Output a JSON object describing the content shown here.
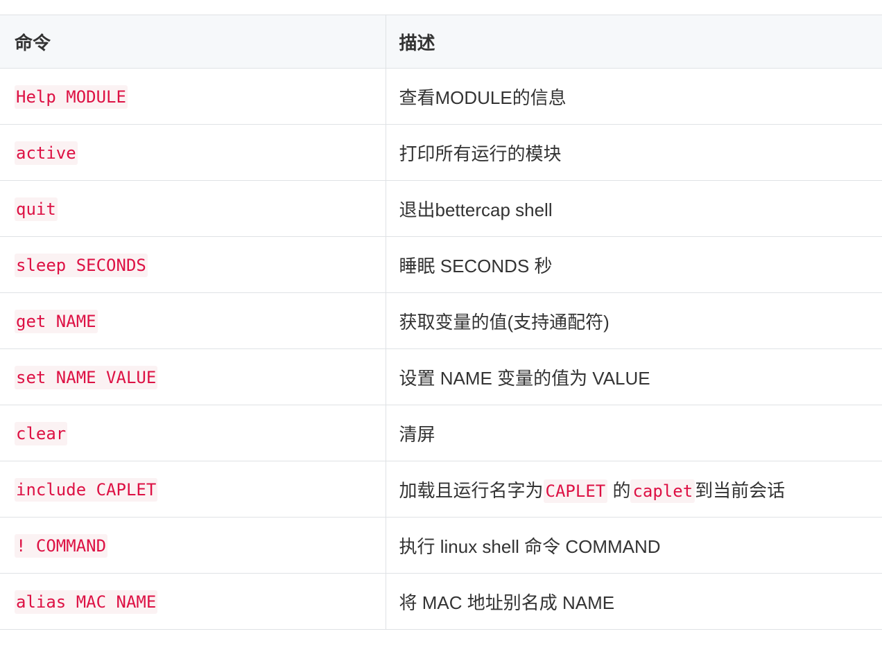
{
  "table": {
    "headers": {
      "command": "命令",
      "description": "描述"
    },
    "rows": [
      {
        "command": "Help MODULE",
        "description": "查看MODULE的信息"
      },
      {
        "command": "active",
        "description": "打印所有运行的模块"
      },
      {
        "command": "quit",
        "description": "退出bettercap shell"
      },
      {
        "command": "sleep SECONDS",
        "description": "睡眠 SECONDS 秒"
      },
      {
        "command": "get NAME",
        "description": "获取变量的值(支持通配符)"
      },
      {
        "command": "set NAME VALUE",
        "description": "设置 NAME 变量的值为 VALUE"
      },
      {
        "command": "clear",
        "description": "清屏"
      },
      {
        "command": "include CAPLET",
        "description_parts": [
          "加载且运行名字为",
          "CAPLET",
          " 的",
          "caplet",
          "到当前会话"
        ]
      },
      {
        "command": "! COMMAND",
        "description": "执行 linux shell 命令 COMMAND"
      },
      {
        "command": "alias MAC NAME",
        "description": "将 MAC 地址别名成 NAME"
      }
    ]
  },
  "colors": {
    "code_text": "#dd1144",
    "code_background": "#fbf2f3",
    "header_background": "#f6f8fa",
    "border": "#dfe2e5"
  }
}
